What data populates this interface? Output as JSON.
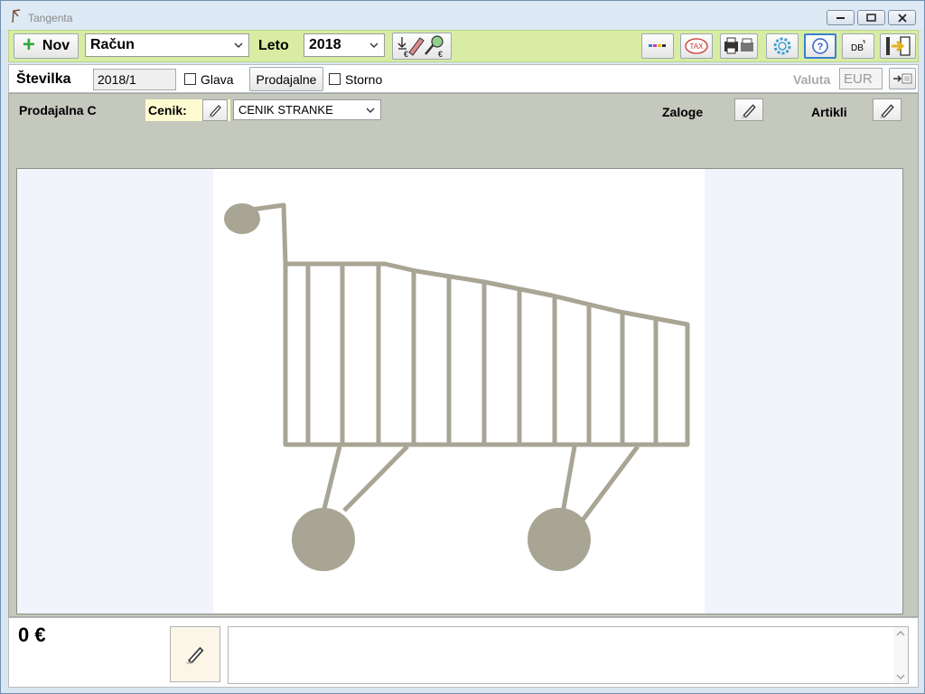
{
  "window": {
    "title": "Tangenta"
  },
  "toolbar": {
    "new_label": "Nov",
    "doc_type": "Račun",
    "year_label": "Leto",
    "year_value": "2018"
  },
  "header": {
    "number_label": "Številka",
    "number_value": "2018/1",
    "head_label": "Glava",
    "stores_button": "Prodajalne",
    "storno_label": "Storno",
    "currency_label": "Valuta",
    "currency_value": "EUR"
  },
  "store": {
    "name": "Prodajalna C",
    "pricelist_label": "Cenik:",
    "pricelist_value": "CENIK STRANKE",
    "stock_label": "Zaloge",
    "items_label": "Artikli"
  },
  "footer": {
    "total": "0 €",
    "notes": ""
  },
  "icons": {
    "print_bar": "color-bars-icon",
    "tax": "TAX",
    "db": "DB",
    "help": "?"
  },
  "colors": {
    "toolbar_bg": "#d8eda3",
    "panel_bg": "#c5c8bc",
    "pricelist_highlight": "#fffbd0",
    "cart_gray": "#a8a595"
  }
}
